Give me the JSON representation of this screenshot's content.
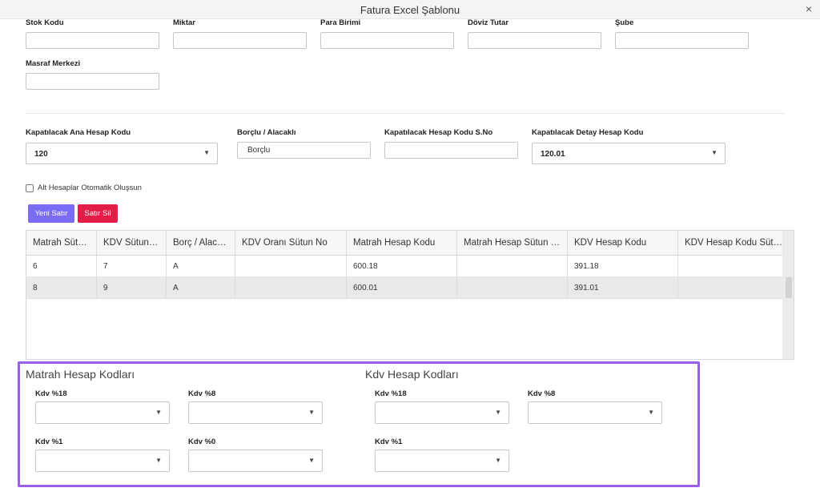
{
  "window": {
    "title": "Fatura Excel Şablonu",
    "close_glyph": "×"
  },
  "fields_row1": [
    {
      "label": "Stok Kodu",
      "value": ""
    },
    {
      "label": "Miktar",
      "value": ""
    },
    {
      "label": "Para Birimi",
      "value": ""
    },
    {
      "label": "Döviz Tutar",
      "value": ""
    },
    {
      "label": "Şube",
      "value": ""
    }
  ],
  "field_masraf": {
    "label": "Masraf Merkezi",
    "value": ""
  },
  "fields_row2": {
    "ana_hesap": {
      "label": "Kapatılacak Ana Hesap Kodu",
      "value": "120"
    },
    "borclu": {
      "label": "Borçlu / Alacaklı",
      "value": "Borçlu"
    },
    "sno": {
      "label": "Kapatılacak Hesap Kodu S.No",
      "value": ""
    },
    "detay": {
      "label": "Kapatılacak Detay Hesap Kodu",
      "value": "120.01"
    }
  },
  "checkbox": {
    "label": "Alt Hesaplar Otomatik Oluşsun",
    "checked": false
  },
  "buttons": {
    "new": "Yeni Satır",
    "delete": "Satır Sil"
  },
  "grid": {
    "columns": [
      "Matrah Sütun No",
      "KDV Sütun No",
      "Borç / Alacak Sütun No",
      "KDV Oranı Sütun No",
      "Matrah Hesap Kodu",
      "Matrah Hesap Sütun No",
      "KDV Hesap Kodu",
      "KDV Hesap Kodu Sütun No"
    ],
    "rows": [
      [
        "6",
        "7",
        "A",
        "",
        "600.18",
        "",
        "391.18",
        ""
      ],
      [
        "8",
        "9",
        "A",
        "",
        "600.01",
        "",
        "391.01",
        ""
      ]
    ]
  },
  "panel": {
    "matrah": {
      "title": "Matrah Hesap Kodları",
      "kdv18": "Kdv %18",
      "kdv8": "Kdv %8",
      "kdv1": "Kdv %1",
      "kdv0": "Kdv %0"
    },
    "kdv": {
      "title": "Kdv Hesap Kodları",
      "kdv18": "Kdv %18",
      "kdv8": "Kdv %8",
      "kdv1": "Kdv %1"
    }
  },
  "icons": {
    "dropdown": "chevron-down-icon",
    "close": "close-icon"
  },
  "colors": {
    "primary_button": "#7b6cf5",
    "danger_button": "#e11d48",
    "highlight_border": "#9b5de5"
  }
}
